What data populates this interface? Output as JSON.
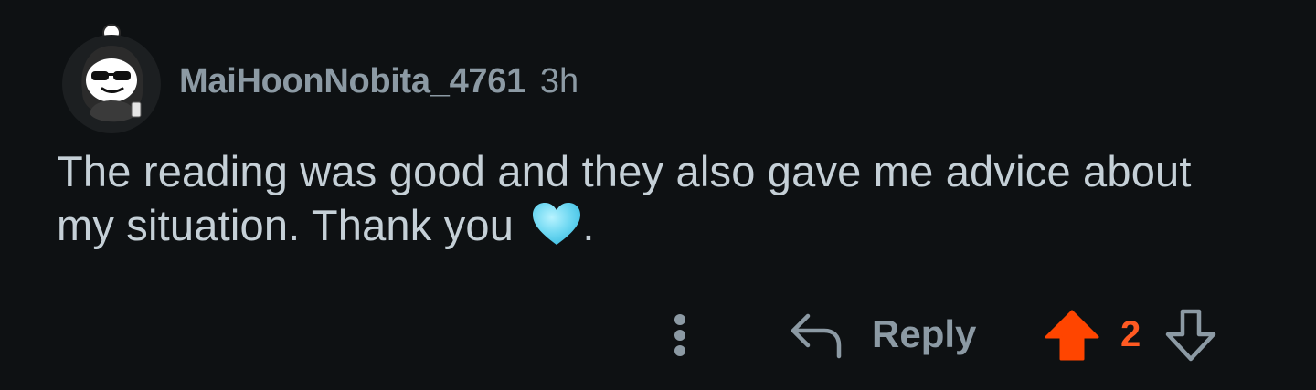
{
  "comment": {
    "username": "MaiHoonNobita_4761",
    "timestamp": "3h",
    "body": "The reading was good and they also gave me advice about my situation. Thank you",
    "body_emoji": "light-blue-heart",
    "body_trailing": "."
  },
  "actions": {
    "more_icon": "vertical-ellipsis-icon",
    "reply_icon": "reply-arrow-icon",
    "reply_label": "Reply",
    "upvote_icon": "upvote-arrow-icon",
    "upvote_state": "active",
    "score": "2",
    "downvote_icon": "downvote-arrow-icon"
  },
  "colors": {
    "background": "#0e1113",
    "text": "#c5d0d7",
    "muted": "#8c9aa4",
    "upvote": "#ff4500",
    "heart": "#6fd8f2"
  }
}
